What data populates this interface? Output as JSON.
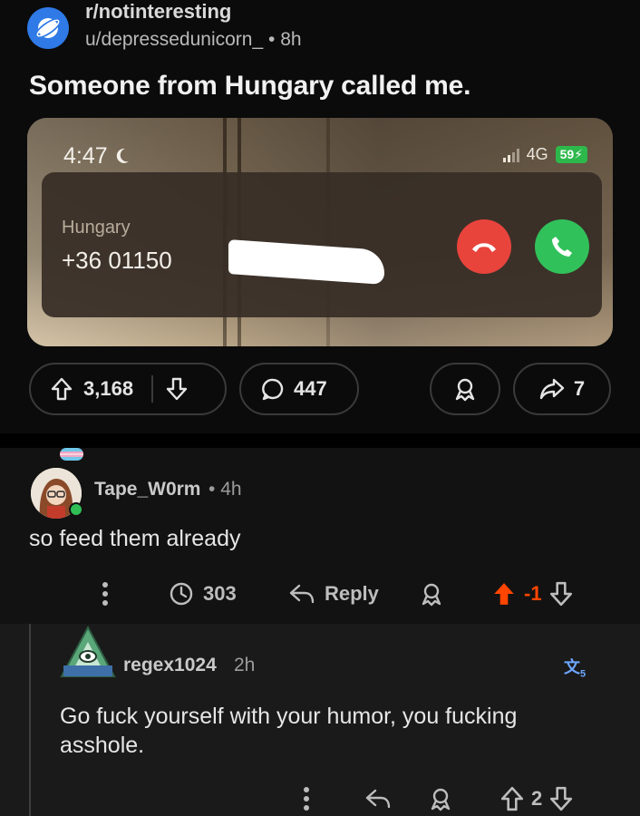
{
  "post": {
    "subreddit": "r/notinteresting",
    "author": "u/depressedunicorn_",
    "separator": "•",
    "age": "8h",
    "title": "Someone from Hungary called me.",
    "screenshot": {
      "time": "4:47",
      "network": "4G",
      "battery": "59",
      "caller_country": "Hungary",
      "caller_number": "+36 01150"
    },
    "upvotes": "3,168",
    "comments": "447",
    "shares": "7"
  },
  "comments": [
    {
      "user": "Tape_W0rm",
      "separator": "•",
      "age": "4h",
      "body": "so feed them already",
      "award_count": "303",
      "reply_label": "Reply",
      "score": "-1"
    },
    {
      "user": "regex1024",
      "age": "2h",
      "body": "Go fuck yourself with your humor, you fucking asshole.",
      "score": "2"
    }
  ],
  "colors": {
    "upvote_active": "#ff4500",
    "subreddit_icon": "#2f7ae6",
    "decline": "#e8443c",
    "accept": "#31c15a",
    "translate": "#6ea7ff"
  },
  "icons": [
    "planet-icon",
    "moon-icon",
    "signal-icon",
    "phone-decline-icon",
    "phone-accept-icon",
    "upvote-icon",
    "downvote-icon",
    "comment-icon",
    "award-icon",
    "share-icon",
    "more-icon",
    "clock-award-icon",
    "reply-icon",
    "translate-icon"
  ]
}
